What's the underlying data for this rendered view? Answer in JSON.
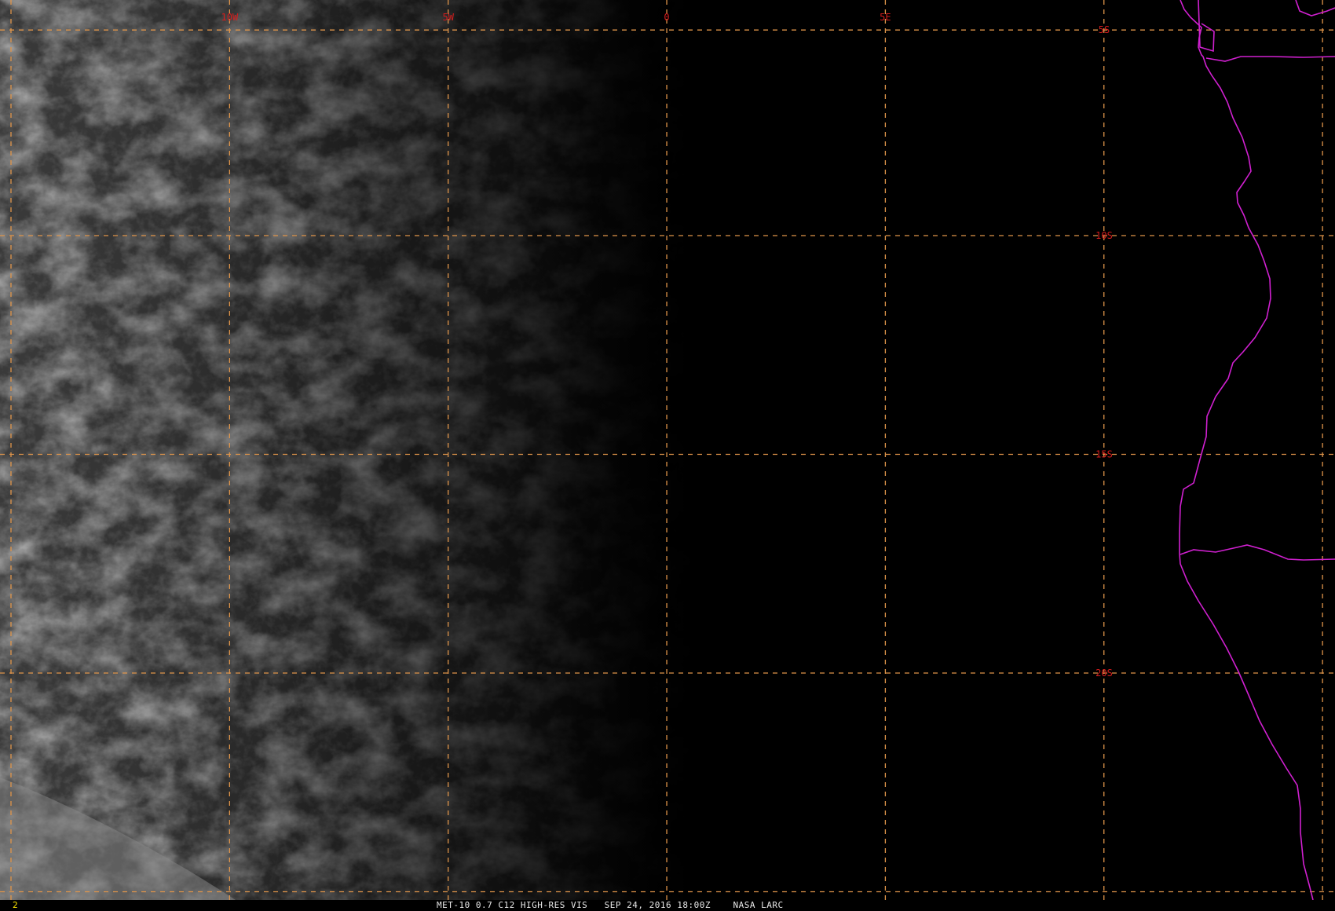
{
  "map": {
    "type": "satellite-visible-imagery",
    "projection_extent": {
      "lon_range": [
        -12.5,
        18.5
      ],
      "lat_range": [
        -25.5,
        -5.0
      ]
    },
    "colors": {
      "background": "#000000",
      "grid_lines": "#e0954a",
      "grid_labels": "#d41c1c",
      "coastline": "#d020d0",
      "frame_number": "#ffe600",
      "caption": "#e8e8e8"
    },
    "meridians": [
      {
        "lon": -12.0,
        "label": ""
      },
      {
        "lon": -7.0,
        "label": "10W"
      },
      {
        "lon": -2.0,
        "label": "5W"
      },
      {
        "lon": 3.0,
        "label": "0"
      },
      {
        "lon": 8.0,
        "label": "5E"
      },
      {
        "lon": 13.0,
        "label": ""
      },
      {
        "lon": 18.0,
        "label": ""
      }
    ],
    "parallels": [
      {
        "lat": -5.3,
        "label": "5S"
      },
      {
        "lat": -10.0,
        "label": "10S"
      },
      {
        "lat": -15.0,
        "label": "15S"
      },
      {
        "lat": -20.0,
        "label": "20S"
      },
      {
        "lat": -25.0,
        "label": ""
      }
    ],
    "features": [
      {
        "name": "africa-coastline",
        "kind": "coastline"
      },
      {
        "name": "dr-congo-angola-border",
        "kind": "political-boundary"
      },
      {
        "name": "cabinda-border",
        "kind": "political-boundary"
      },
      {
        "name": "angola-namibia-border",
        "kind": "political-boundary"
      },
      {
        "name": "cloud-field",
        "kind": "stratocumulus deck, sunlit western side"
      },
      {
        "name": "terminator",
        "kind": "day-night boundary"
      }
    ]
  },
  "status_bar": {
    "frame_number": "2",
    "caption": "MET-10 0.7 C12 HIGH-RES VIS   SEP 24, 2016 18:00Z    NASA LARC"
  }
}
